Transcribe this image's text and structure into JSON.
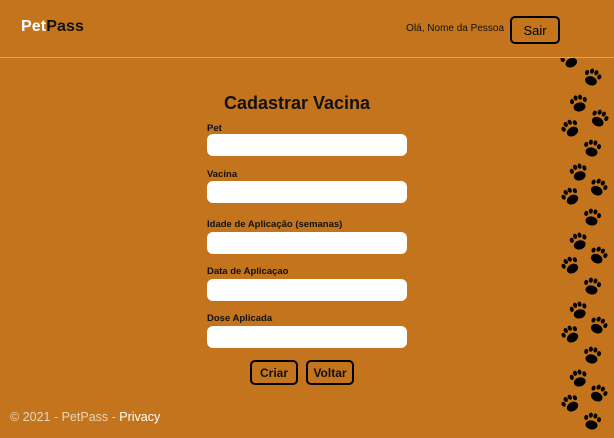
{
  "theme": {
    "background": "#c3741c",
    "brand_light": "#ffffff",
    "brand_dark": "#111111"
  },
  "header": {
    "brand_part1": "Pet",
    "brand_part2": "Pass",
    "greeting": "Olá, Nome da Pessoa",
    "logout_label": "Sair"
  },
  "form": {
    "title": "Cadastrar Vacina",
    "fields": [
      {
        "label": "Pet",
        "value": ""
      },
      {
        "label": "Vacina",
        "value": ""
      },
      {
        "label": "Idade de Aplicação (semanas)",
        "value": ""
      },
      {
        "label": "Data de Aplicaçao",
        "value": ""
      },
      {
        "label": "Dose Aplicada",
        "value": ""
      }
    ],
    "create_label": "Criar",
    "back_label": "Voltar"
  },
  "footer": {
    "copyright": "© 2021 - PetPass - ",
    "privacy_label": "Privacy"
  },
  "decor": {
    "icon": "paw-print-icon"
  }
}
